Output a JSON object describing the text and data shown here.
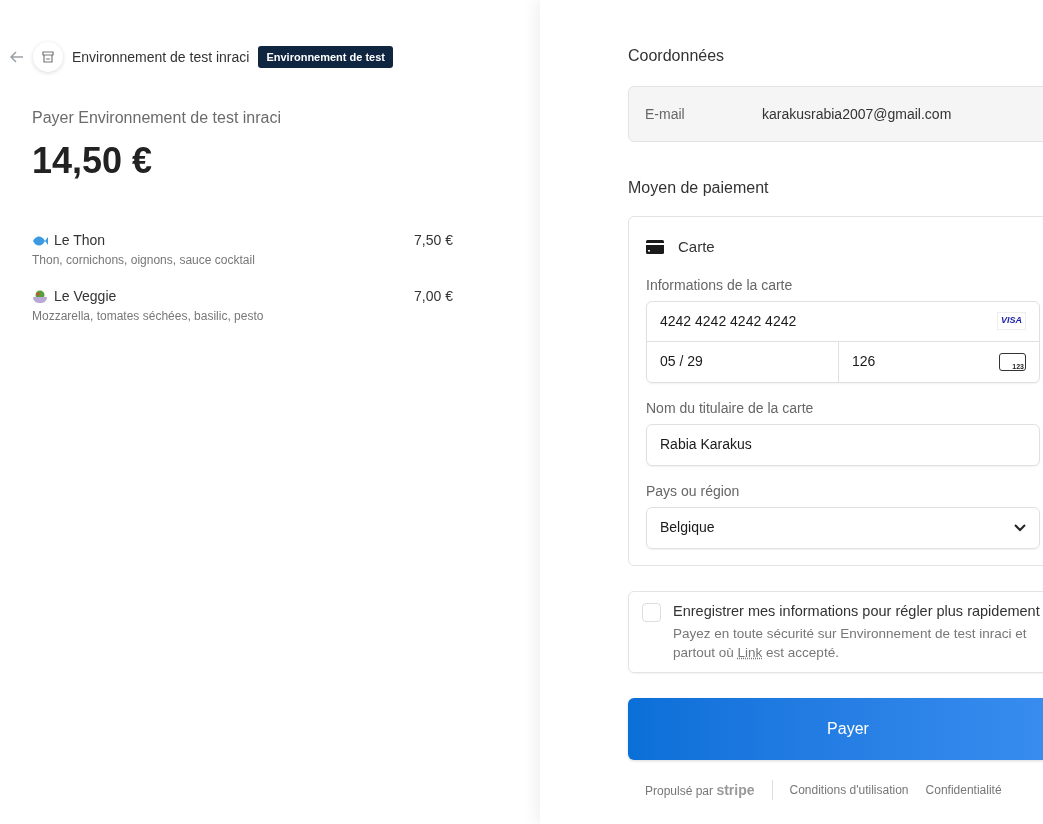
{
  "header": {
    "merchant": "Environnement de test inraci",
    "badge": "Environnement de test"
  },
  "summary": {
    "title": "Payer Environnement de test inraci",
    "amount": "14,50 €"
  },
  "items": [
    {
      "name": "Le Thon",
      "description": "Thon, cornichons, oignons, sauce cocktail",
      "price": "7,50 €",
      "kind": "fish"
    },
    {
      "name": "Le Veggie",
      "description": "Mozzarella, tomates séchées, basilic, pesto",
      "price": "7,00 €",
      "kind": "salad"
    }
  ],
  "contact": {
    "heading": "Coordonnées",
    "email_label": "E-mail",
    "email": "karakusrabia2007@gmail.com"
  },
  "payment": {
    "heading": "Moyen de paiement",
    "method": "Carte",
    "card_label": "Informations de la carte",
    "card_number": "4242 4242 4242 4242",
    "card_brand": "VISA",
    "expiry": "05 / 29",
    "cvc": "126",
    "cvc_icon_text": "123",
    "name_label": "Nom du titulaire de la carte",
    "name": "Rabia Karakus",
    "country_label": "Pays ou région",
    "country": "Belgique"
  },
  "save": {
    "checked": false,
    "label": "Enregistrer mes informations pour régler plus rapidement",
    "note_before": "Payez en toute sécurité sur Environnement de test inraci et partout où",
    "note_link": "Link",
    "note_after": "est accepté."
  },
  "pay_button": "Payer",
  "footer": {
    "powered": "Propulsé par",
    "brand": "stripe",
    "links": [
      "Conditions d'utilisation",
      "Confidentialité"
    ]
  }
}
